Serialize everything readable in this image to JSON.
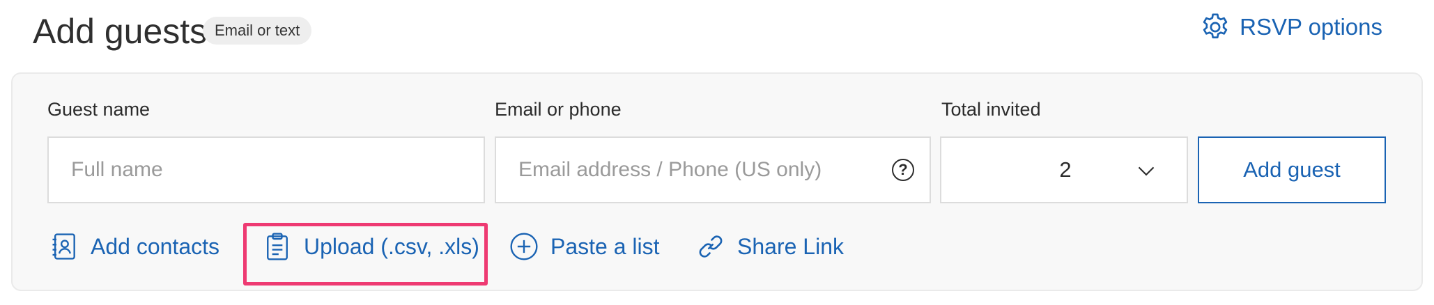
{
  "header": {
    "title": "Add guests",
    "badge": "Email or text",
    "rsvp_label": "RSVP options"
  },
  "form": {
    "guest_name": {
      "label": "Guest name",
      "placeholder": "Full name",
      "value": ""
    },
    "email_phone": {
      "label": "Email or phone",
      "placeholder": "Email address / Phone (US only)",
      "value": "",
      "help_icon": "?"
    },
    "total_invited": {
      "label": "Total invited",
      "selected": "2"
    },
    "add_button": "Add guest"
  },
  "actions": {
    "add_contacts": "Add contacts",
    "upload": "Upload (.csv, .xls)",
    "paste_list": "Paste a list",
    "share_link": "Share Link"
  },
  "colors": {
    "accent": "#1a63b3",
    "highlight": "#ee3a72",
    "panel_bg": "#f8f8f8"
  }
}
